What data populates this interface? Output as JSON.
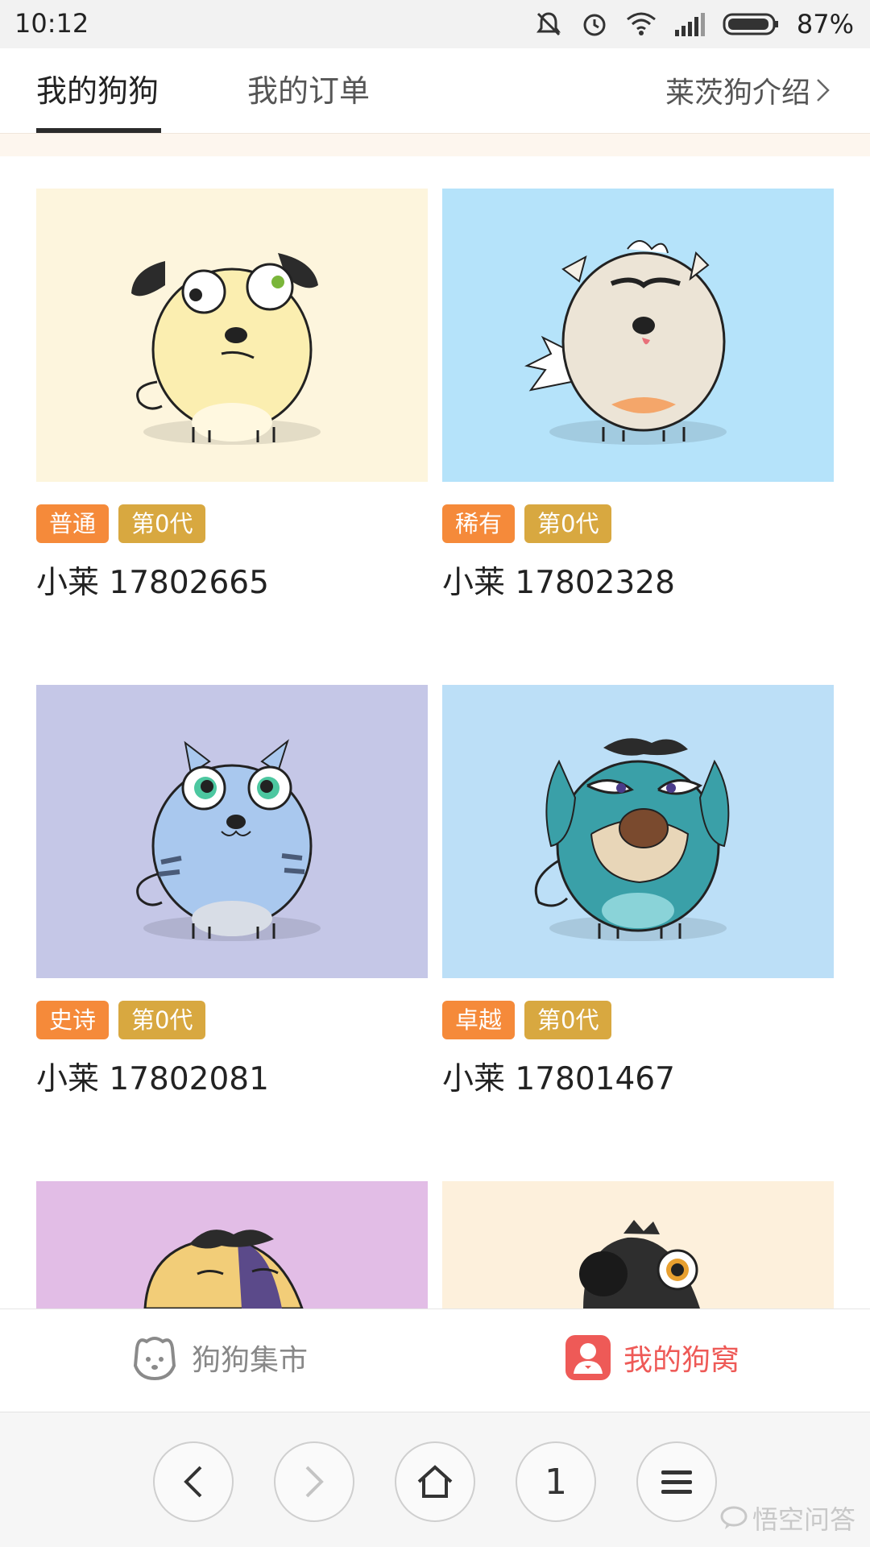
{
  "status_bar": {
    "time": "10:12",
    "battery": "87%"
  },
  "tabs": {
    "my_dogs": "我的狗狗",
    "my_orders": "我的订单",
    "intro": "莱茨狗介绍"
  },
  "cards": [
    {
      "rarity": "普通",
      "generation": "第0代",
      "name": "小莱 17802665",
      "bg": "#fdf5dd",
      "body": "#fbeeb0"
    },
    {
      "rarity": "稀有",
      "generation": "第0代",
      "name": "小莱 17802328",
      "bg": "#b5e3fa",
      "body": "#ece4d6"
    },
    {
      "rarity": "史诗",
      "generation": "第0代",
      "name": "小莱 17802081",
      "bg": "#c5c7e7",
      "body": "#a9c8ee"
    },
    {
      "rarity": "卓越",
      "generation": "第0代",
      "name": "小莱 17801467",
      "bg": "#bcdff7",
      "body": "#3aa0a8"
    },
    {
      "bg": "#e2bde6",
      "body": "#f2cd78"
    },
    {
      "bg": "#fdf0dc",
      "body": "#2e2e2e"
    }
  ],
  "bottom_nav": {
    "market": "狗狗集市",
    "kennel": "我的狗窝"
  },
  "browser": {
    "tabs_count": "1"
  },
  "watermark": "悟空问答",
  "colors": {
    "rarity_badge": "#f58a3a",
    "generation_badge": "#d8a840",
    "active_nav": "#ee5a57"
  }
}
